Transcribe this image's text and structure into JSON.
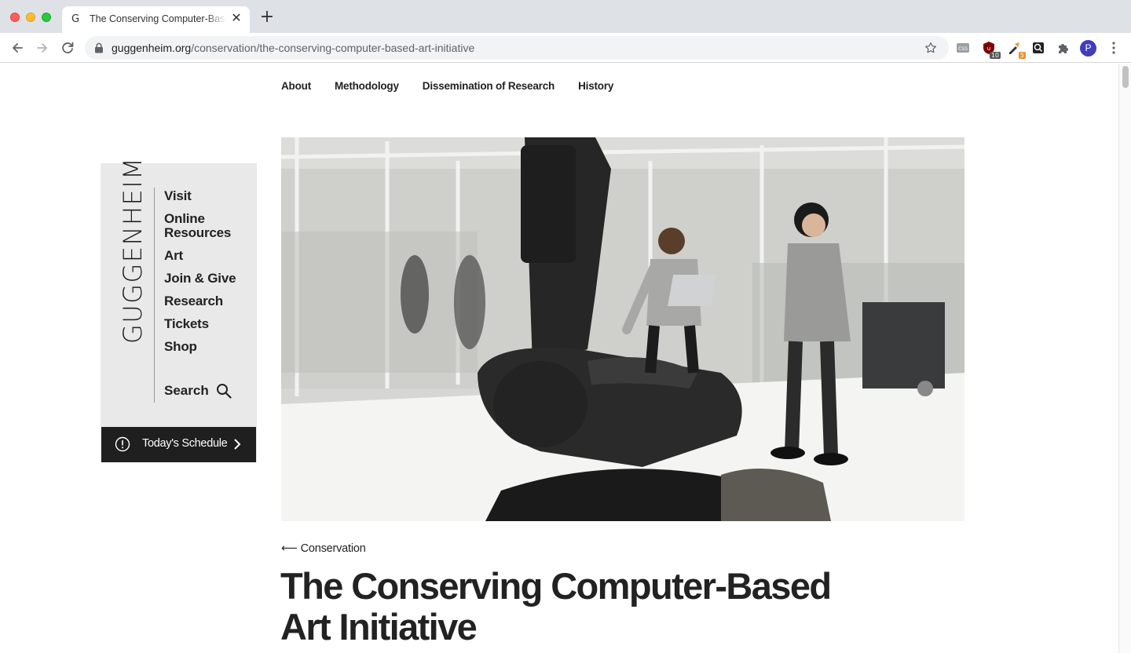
{
  "browser": {
    "tab_title": "The Conserving Computer-Based Art Initiative",
    "tab_favicon": "G",
    "url_host": "guggenheim.org",
    "url_path": "/conservation/the-conserving-computer-based-art-initiative",
    "extensions": [
      {
        "icon": "css-viewer-icon",
        "badge": ""
      },
      {
        "icon": "ublock-icon",
        "badge": "10"
      },
      {
        "icon": "eyedropper-icon",
        "badge": "5"
      },
      {
        "icon": "zoom-icon",
        "badge": ""
      },
      {
        "icon": "puzzle-icon",
        "badge": ""
      }
    ],
    "profile_initial": "P"
  },
  "subnav": {
    "about": "About",
    "methodology": "Methodology",
    "dissemination": "Dissemination of Research",
    "history": "History"
  },
  "sidebar": {
    "logo": "GUGGENHEIM",
    "items": [
      "Visit",
      "Online Resources",
      "Art",
      "Join & Give",
      "Research",
      "Tickets",
      "Shop"
    ],
    "search_label": "Search",
    "schedule_label": "Today's Schedule"
  },
  "article": {
    "back_arrow": "⟵",
    "back_label": "Conservation",
    "title": "The Conserving Computer-Based Art Initiative"
  },
  "colors": {
    "sidebar_bg": "#e9e9e9",
    "schedule_bg": "#1f1f1f",
    "text": "#222222"
  }
}
